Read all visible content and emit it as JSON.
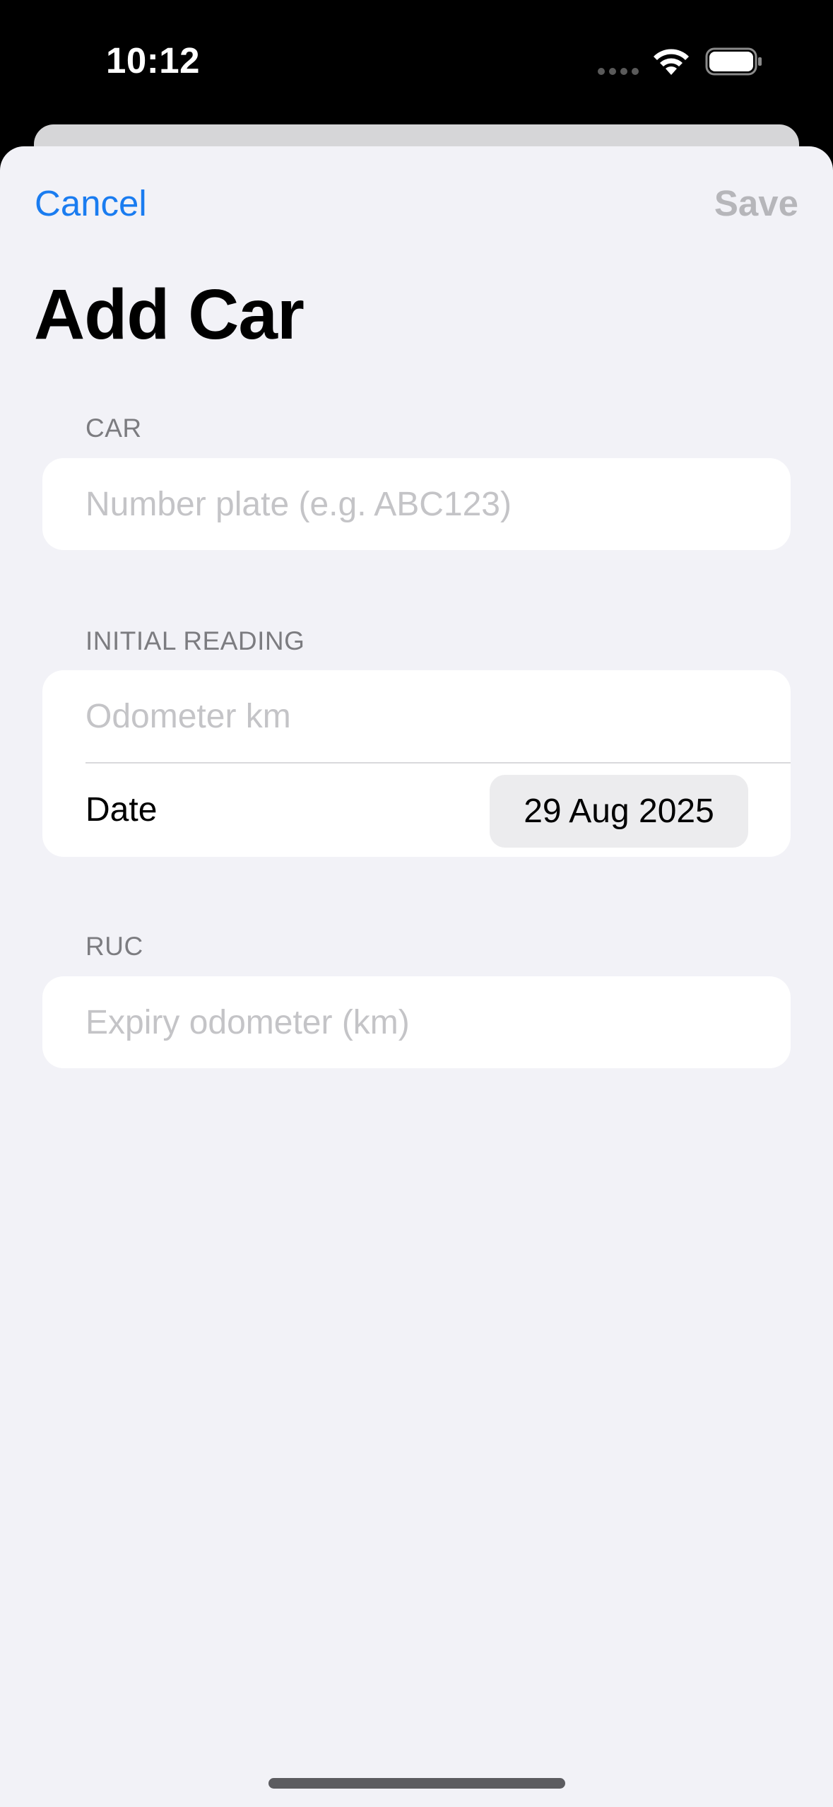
{
  "status_bar": {
    "time": "10:12",
    "icons": [
      "cellular-dots-icon",
      "wifi-icon",
      "battery-icon"
    ]
  },
  "nav": {
    "cancel_label": "Cancel",
    "save_label": "Save"
  },
  "page": {
    "title": "Add Car"
  },
  "sections": {
    "car": {
      "header": "CAR",
      "number_plate_placeholder": "Number plate (e.g. ABC123)",
      "number_plate_value": ""
    },
    "initial_reading": {
      "header": "INITIAL READING",
      "odometer_placeholder": "Odometer km",
      "odometer_value": "",
      "date_label": "Date",
      "date_value": "29 Aug 2025"
    },
    "ruc": {
      "header": "RUC",
      "expiry_placeholder": "Expiry odometer (km)",
      "expiry_value": ""
    }
  },
  "colors": {
    "accent": "#1a7cf0",
    "background": "#f2f2f7",
    "card": "#ffffff",
    "disabled_text": "#b6b6ba",
    "section_header": "#7c7c80",
    "placeholder": "#c4c4c7"
  }
}
